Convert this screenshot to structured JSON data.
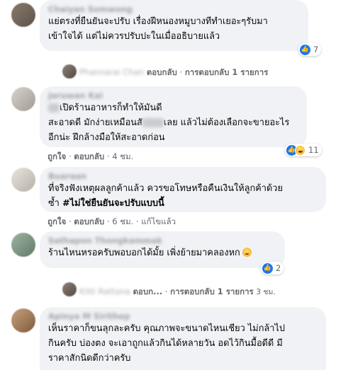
{
  "comments": [
    {
      "author": "Chaiyan Somwong",
      "lines": [
        "แย่ตรงที่ยืนยันจะปรับ เรื่องฝีหนองหมูบางทีทำเยอะๆรับมา",
        "เข้าใจได้ แต่ไม่ควรปรับปะในเมื่ออธิบายแล้ว"
      ],
      "reaction_count": "7",
      "replies": {
        "blurred_name": "Phannarai Chan",
        "reply_link": "ตอบกลับ",
        "separator": "·",
        "replies_label": "การตอบกลับ 1 รายการ"
      }
    },
    {
      "author": "Jaruwan Kai",
      "line1_tail": "เปิดร้านอาหารก็ทำให้มันดี",
      "line2_head": "สะอาดดี มักง่ายเหมือนสั",
      "line2_tail": "เลย แล้วไม่ต้องเลือกจะขายอะไร",
      "line3": "อีกน่ะ ฝึกล้างมือให้สะอาดก่อน",
      "meta": {
        "like": "ถูกใจ",
        "reply": "ตอบกลับ",
        "time": "4 ชม.",
        "sep": "·"
      },
      "reaction_count": "11"
    },
    {
      "author": "Buaraan",
      "lines": [
        "ที่จริงฟังเหตุผลลูกค้าแล้ว ควรขอโทษหรือคืนเงินให้ลูกค้าด้วย"
      ],
      "line2_prefix": "ซ้ำ",
      "hashtag": "#ไม่ใช่ยืนยันจะปรับแบบนี้",
      "meta": {
        "like": "ถูกใจ",
        "reply": "ตอบกลับ",
        "time": "6 ชม.",
        "edited": "แก้ไขแล้ว",
        "sep": "·"
      }
    },
    {
      "author": "Sathapon Thongkammak",
      "lines": [
        "ร้านไหนหรอครับพอบอกได้มั้ย เพิ่งย้ายมาคลองหก"
      ],
      "reaction_count": "2",
      "replies": {
        "blurred_name": "Kitti Rattana",
        "reply_link": "ตอบก...",
        "separator": "·",
        "replies_label": "การตอบกลับ 1 รายการ",
        "time": "3 ชม."
      }
    },
    {
      "author": "Apinya M Sirithep",
      "lines": [
        "เห็นราคาก็ขนลุกละครับ คุณภาพจะขนาดไหนเชียว ไม่กล้าไป",
        "กินครับ บ่องตง จะเอาถูกแล้วกินได้หลายวัน อดไว้กินมื้อดีดี มี",
        "ราคาสักนิดดีกว่าครับ"
      ]
    }
  ],
  "colors": {
    "like_blue": "#1877f2",
    "bubble_bg": "#f0f2f5",
    "meta_gray": "#65676b"
  },
  "icons": {
    "like": "like-thumb-icon",
    "haha": "haha-emoji-icon",
    "reply": "reply-arrow-icon"
  }
}
